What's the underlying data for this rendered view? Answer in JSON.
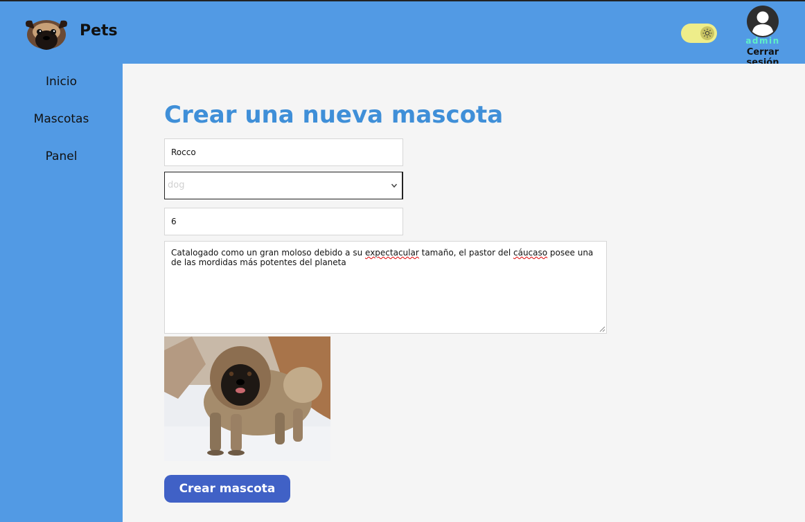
{
  "header": {
    "brand": "Pets",
    "user": {
      "name": "admin",
      "logout_label": "Cerrar sesión"
    },
    "theme_toggle": {
      "mode": "light",
      "icon": "sun-icon"
    }
  },
  "sidebar": {
    "items": [
      {
        "label": "Inicio"
      },
      {
        "label": "Mascotas"
      },
      {
        "label": "Panel"
      }
    ]
  },
  "form": {
    "title": "Crear una nueva mascota",
    "name_value": "Rocco",
    "type_value": "dog",
    "age_value": "6",
    "description_value": "Catalogado como un gran moloso debido a su expectacular tamaño, el pastor del cáucaso posee una de las mordidas más potentes del planeta",
    "desc_part1": "Catalogado como un gran moloso debido a su ",
    "desc_word1": "expectacular",
    "desc_part2": " tamaño, el pastor del ",
    "desc_word2": "cáucaso",
    "desc_part3": " posee una de las mordidas más potentes del planeta",
    "submit_label": "Crear mascota"
  },
  "colors": {
    "header_bg": "#529ae4",
    "title": "#3f8fd8",
    "button": "#4061c6",
    "username": "#5ff0c8",
    "toggle": "#eeed8a"
  }
}
